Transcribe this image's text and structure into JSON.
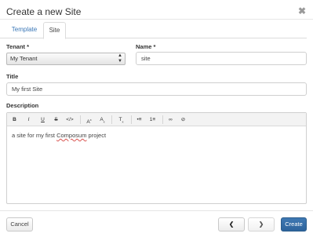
{
  "dialog": {
    "title": "Create a new Site",
    "close_icon": "close-icon"
  },
  "tabs": [
    {
      "label": "Template",
      "active": false
    },
    {
      "label": "Site",
      "active": true
    }
  ],
  "form": {
    "tenant_label": "Tenant *",
    "tenant_value": "My Tenant",
    "name_label": "Name *",
    "name_value": "site",
    "title_label": "Title",
    "title_value": "My first Site",
    "description_label": "Description",
    "description_prefix": "a site for my first ",
    "description_typo": "Composum",
    "description_suffix": " project"
  },
  "toolbar": {
    "bold": "B",
    "italic": "I",
    "underline": "U",
    "strike": "S",
    "code": "</>",
    "superscript": "A",
    "superscript_mark": "x",
    "subscript": "A",
    "subscript_mark": "x",
    "clear_format": "T",
    "clear_format_mark": "x",
    "bullet_list": "•≡",
    "numbered_list": "1≡",
    "link": "∞",
    "unlink": "⊘"
  },
  "footer": {
    "cancel_label": "Cancel",
    "prev_label": "❮",
    "next_label": "❯",
    "create_label": "Create"
  },
  "colors": {
    "accent": "#3a77b7",
    "primary_button": "#3470a8",
    "spellcheck": "#d9534f"
  }
}
